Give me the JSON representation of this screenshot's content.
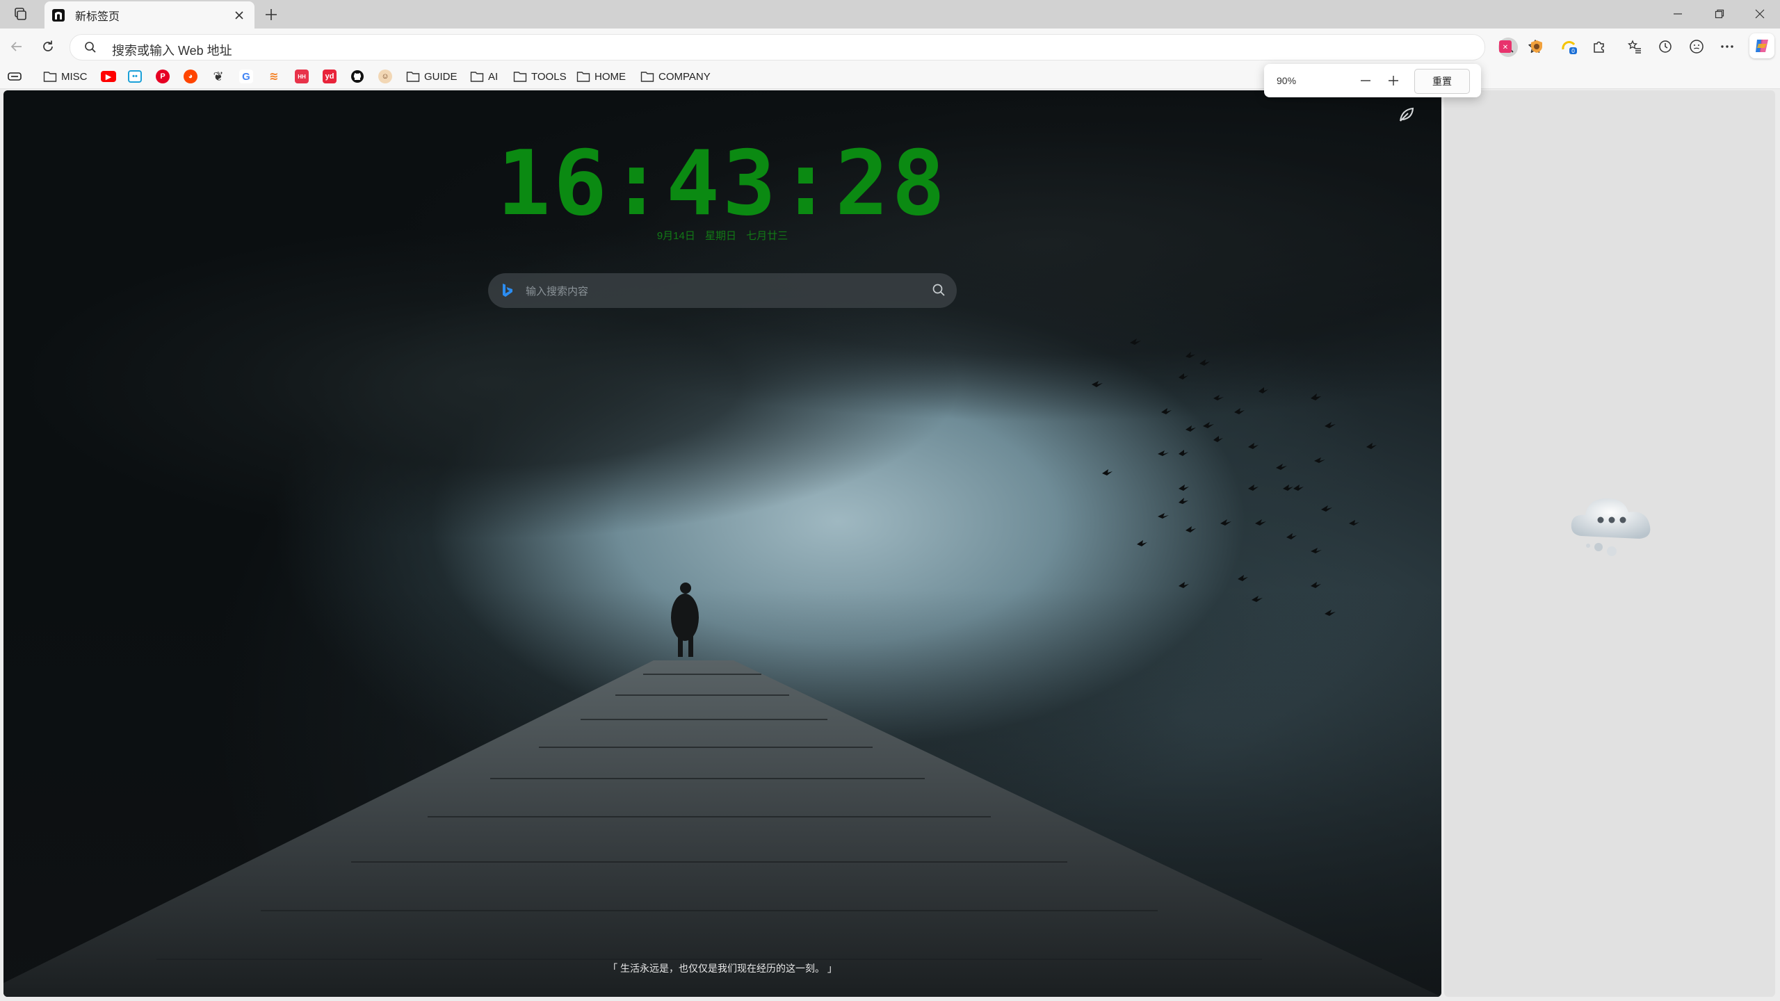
{
  "browser": {
    "tab": {
      "title": "新标签页"
    },
    "omnibox": {
      "placeholder": "搜索或输入 Web 地址"
    },
    "window_controls": {
      "minimize": "—",
      "restore": "❐",
      "close": "✕"
    },
    "toolbar_icons": [
      "zoom-out-icon",
      "favorite-star-icon",
      "image-extension-icon",
      "shield-extension-icon",
      "speed-extension-icon",
      "extensions-puzzle-icon",
      "favorites-icon",
      "history-icon",
      "feedback-icon",
      "more-menu-icon",
      "copilot-icon"
    ],
    "extension_badge": "0"
  },
  "bookmarks": {
    "folders": {
      "misc": "MISC",
      "guide": "GUIDE",
      "ai": "AI",
      "tools": "TOOLS",
      "home": "HOME",
      "company": "COMPANY"
    },
    "icons": [
      "youtube-icon",
      "bilibili-icon",
      "pinterest-icon",
      "reddit-icon",
      "feather-icon",
      "google-icon",
      "stackoverflow-icon",
      "hacker-icon",
      "youdao-icon",
      "github-icon",
      "avatar-icon"
    ]
  },
  "newtab": {
    "clock": "16:43:28",
    "date": "9月14日 星期日 七月廿三",
    "search": {
      "placeholder": "输入搜索内容"
    },
    "quote": "「 生活永远是，也仅仅是我们现在经历的这一刻。 」"
  },
  "zoom_popup": {
    "level": "90%",
    "minus": "—",
    "plus": "+",
    "reset": "重置"
  },
  "colors": {
    "clock": "#0b8a12",
    "page_bg": "#0d1214",
    "accent_bing": "#2b8cf0"
  }
}
